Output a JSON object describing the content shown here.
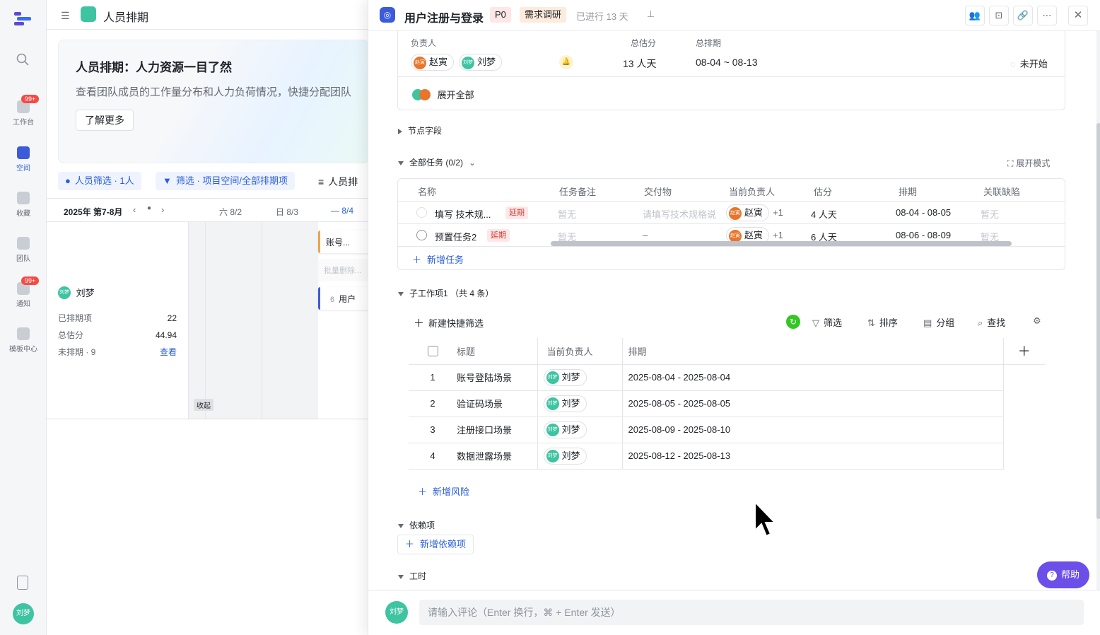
{
  "rail": {
    "items": [
      {
        "label": "工作台",
        "badge": "99+"
      },
      {
        "label": "空间"
      },
      {
        "label": "收藏"
      },
      {
        "label": "团队"
      },
      {
        "label": "通知",
        "badge": "99+"
      },
      {
        "label": "模板中心"
      }
    ],
    "user_avatar": "刘梦"
  },
  "bg": {
    "title": "人员排期",
    "banner_title": "人员排期：人力资源一目了然",
    "banner_desc": "查看团队成员的工作量分布和人力负荷情况，快捷分配团队",
    "learn_more": "了解更多",
    "filter_person": "人员筛选 · 1人",
    "filter_project": "筛选 · 项目空间/全部排期项",
    "view_label": "人员排",
    "week": "2025年 第7-8月",
    "days": [
      "六 8/2",
      "日 8/3",
      "— 8/4"
    ],
    "person_name": "刘梦",
    "stats": [
      {
        "label": "已排期项",
        "value": "22"
      },
      {
        "label": "总估分",
        "value": "44.94"
      },
      {
        "label": "未排期 · 9",
        "value": "查看"
      }
    ],
    "collapse": "收起",
    "bars": [
      "账号...",
      "批量删除...",
      "用户"
    ],
    "bar_count": "6"
  },
  "drawer": {
    "title": "用户注册与登录",
    "priority": "P0",
    "stage": "需求调研",
    "elapsed": "已进行 13 天",
    "summary": {
      "owner_label": "负责人",
      "score_label": "总估分",
      "schedule_label": "总排期",
      "owners": [
        "赵寅",
        "刘梦"
      ],
      "score": "13 人天",
      "schedule": "08-04 ~ 08-13",
      "status": "未开始",
      "expand_all": "展开全部"
    },
    "node_fields": "节点字段",
    "all_tasks": {
      "title": "全部任务 (0/2)",
      "expand_mode": "展开模式",
      "columns": [
        "名称",
        "任务备注",
        "交付物",
        "当前负责人",
        "估分",
        "排期",
        "关联缺陷"
      ],
      "rows": [
        {
          "name": "填写 技术规...",
          "tag": "延期",
          "note": "暂无",
          "deliverable": "请填写技术规格说",
          "owner": "赵寅",
          "extra": "+1",
          "score": "4 人天",
          "schedule": "08-04 - 08-05",
          "defect": "暂无"
        },
        {
          "name": "预置任务2",
          "tag": "延期",
          "note": "暂无",
          "deliverable": "–",
          "owner": "赵寅",
          "extra": "+1",
          "score": "6 人天",
          "schedule": "08-06 - 08-09",
          "defect": "暂无"
        }
      ],
      "add": "新增任务"
    },
    "subitems": {
      "title": "子工作项1 （共 4 条）",
      "new_filter": "新建快捷筛选",
      "tools": [
        "筛选",
        "排序",
        "分组",
        "查找"
      ],
      "columns": [
        "标题",
        "当前负责人",
        "排期"
      ],
      "rows": [
        {
          "idx": "1",
          "title": "账号登陆场景",
          "owner": "刘梦",
          "schedule": "2025-08-04 - 2025-08-04"
        },
        {
          "idx": "2",
          "title": "验证码场景",
          "owner": "刘梦",
          "schedule": "2025-08-05 - 2025-08-05"
        },
        {
          "idx": "3",
          "title": "注册接口场景",
          "owner": "刘梦",
          "schedule": "2025-08-09 - 2025-08-10"
        },
        {
          "idx": "4",
          "title": "数据泄露场景",
          "owner": "刘梦",
          "schedule": "2025-08-12 - 2025-08-13"
        }
      ],
      "add_risk": "新增风险"
    },
    "deps": {
      "title": "依赖项",
      "add": "新增依赖项"
    },
    "worktime": "工时",
    "comment": {
      "avatar": "刘梦",
      "placeholder": "请输入评论（Enter 换行，⌘ + Enter 发送）"
    },
    "help": "帮助"
  }
}
